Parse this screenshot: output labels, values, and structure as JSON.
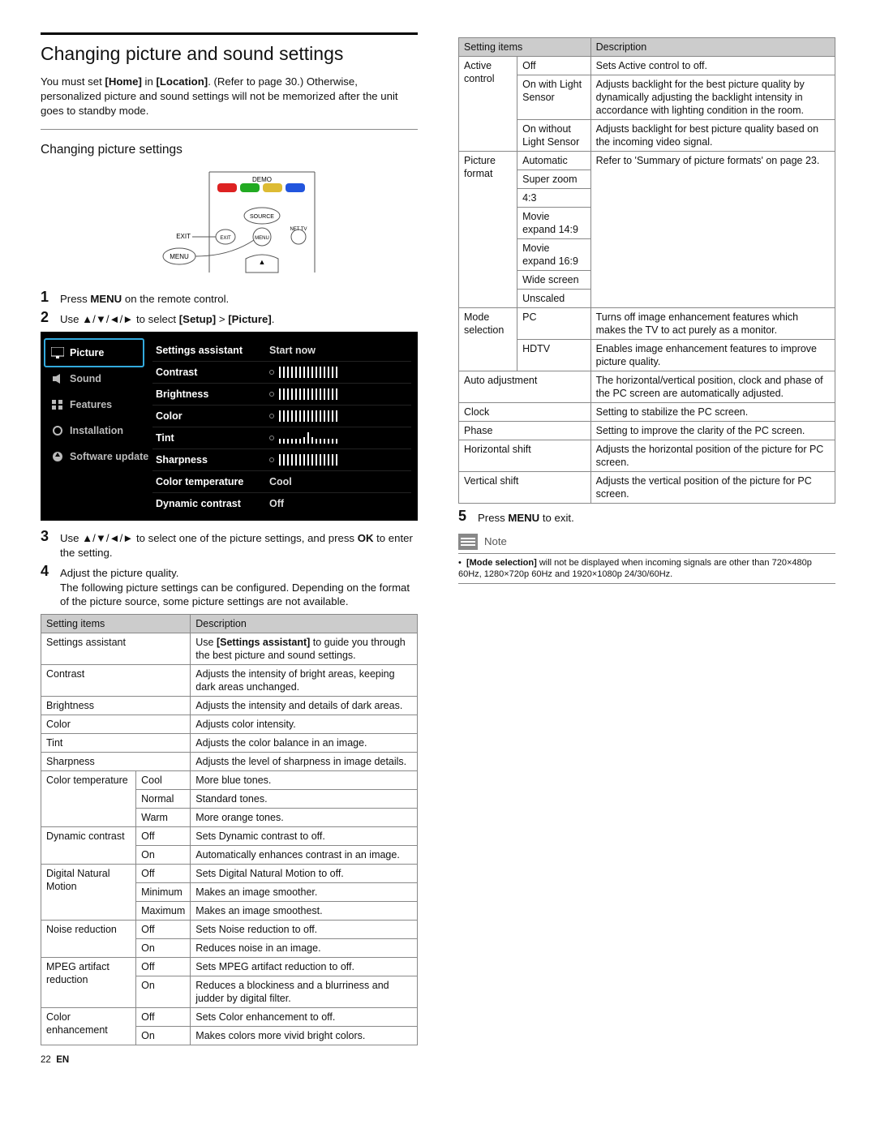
{
  "heading": "Changing picture and sound settings",
  "intro_a": "You must set ",
  "intro_home": "[Home]",
  "intro_b": " in ",
  "intro_location": "[Location]",
  "intro_c": ". (Refer to page 30.) Otherwise, personalized picture and sound settings will not be memorized after the unit goes to standby mode.",
  "sub_heading": "Changing picture settings",
  "remote": {
    "demo": "DEMO",
    "source": "SOURCE",
    "exit_l": "EXIT",
    "exit_s": "EXIT",
    "nettv": "NET TV",
    "menu_l": "MENU",
    "menu_s": "MENU"
  },
  "step1": {
    "n": "1",
    "a": "Press ",
    "menu": "MENU",
    "b": " on the remote control."
  },
  "step2": {
    "n": "2",
    "a": "Use ▲/▼/◄/► to select ",
    "setup": "[Setup]",
    "gt": " > ",
    "picture": "[Picture]",
    "b": "."
  },
  "osd": {
    "side": [
      "Picture",
      "Sound",
      "Features",
      "Installation",
      "Software update"
    ],
    "rows": [
      {
        "label": "Settings assistant",
        "val": "Start now"
      },
      {
        "label": "Contrast",
        "type": "bar"
      },
      {
        "label": "Brightness",
        "type": "bar"
      },
      {
        "label": "Color",
        "type": "bar"
      },
      {
        "label": "Tint",
        "type": "tint"
      },
      {
        "label": "Sharpness",
        "type": "bar"
      },
      {
        "label": "Color temperature",
        "val": "Cool"
      },
      {
        "label": "Dynamic contrast",
        "val": "Off"
      }
    ]
  },
  "step3": {
    "n": "3",
    "a": "Use ▲/▼/◄/► to select one of the picture settings, and press ",
    "ok": "OK",
    "b": " to enter the setting."
  },
  "step4": {
    "n": "4",
    "a": "Adjust the picture quality.",
    "b": "The following picture settings can be configured. Depending on the format of the picture source, some picture settings are not available."
  },
  "table1": {
    "headers": [
      "Setting items",
      "Description"
    ],
    "rows": [
      {
        "c1": "Settings assistant",
        "c2a": "Use ",
        "assist": "[Settings assistant]",
        "c2b": " to guide you through the best picture and sound settings."
      },
      {
        "c1": "Contrast",
        "c2": "Adjusts the intensity of bright areas, keeping dark areas unchanged."
      },
      {
        "c1": "Brightness",
        "c2": "Adjusts the intensity and details of dark areas."
      },
      {
        "c1": "Color",
        "c2": "Adjusts color intensity."
      },
      {
        "c1": "Tint",
        "c2": "Adjusts the color balance in an image."
      },
      {
        "c1": "Sharpness",
        "c2": "Adjusts the level of sharpness in image details."
      },
      {
        "g": "Color temperature",
        "sub": [
          {
            "k": "Cool",
            "v": "More blue tones."
          },
          {
            "k": "Normal",
            "v": "Standard tones."
          },
          {
            "k": "Warm",
            "v": "More orange tones."
          }
        ]
      },
      {
        "g": "Dynamic contrast",
        "sub": [
          {
            "k": "Off",
            "v": "Sets Dynamic contrast to off."
          },
          {
            "k": "On",
            "v": "Automatically enhances contrast in an image."
          }
        ]
      },
      {
        "g": "Digital Natural Motion",
        "sub": [
          {
            "k": "Off",
            "v": "Sets Digital Natural Motion to off."
          },
          {
            "k": "Minimum",
            "v": "Makes an image smoother."
          },
          {
            "k": "Maximum",
            "v": "Makes an image smoothest."
          }
        ]
      },
      {
        "g": "Noise reduction",
        "sub": [
          {
            "k": "Off",
            "v": "Sets Noise reduction to off."
          },
          {
            "k": "On",
            "v": "Reduces noise in an image."
          }
        ]
      },
      {
        "g": "MPEG artifact reduction",
        "sub": [
          {
            "k": "Off",
            "v": "Sets MPEG artifact reduction to off."
          },
          {
            "k": "On",
            "v": "Reduces a blockiness and a blurriness and judder by digital filter."
          }
        ]
      },
      {
        "g": "Color enhancement",
        "sub": [
          {
            "k": "Off",
            "v": "Sets Color enhancement to off."
          },
          {
            "k": "On",
            "v": "Makes colors more vivid bright colors."
          }
        ]
      }
    ]
  },
  "table2": {
    "headers": [
      "Setting items",
      "Description"
    ],
    "rows2": [
      {
        "g": "Active control",
        "sub": [
          {
            "k": "Off",
            "v": "Sets Active control to off."
          },
          {
            "k": "On with Light Sensor",
            "v": "Adjusts backlight for the best picture quality by dynamically adjusting the backlight intensity in accordance with lighting condition in the room."
          },
          {
            "k": "On without Light Sensor",
            "v": "Adjusts backlight for best picture quality based on the incoming video signal."
          }
        ]
      },
      {
        "g": "Picture format",
        "desc": "Refer to 'Summary of picture formats' on page 23.",
        "opts": [
          "Automatic",
          "Super zoom",
          "4:3",
          "Movie expand 14:9",
          "Movie expand 16:9",
          "Wide screen",
          "Unscaled"
        ]
      },
      {
        "g": "Mode selection",
        "sub": [
          {
            "k": "PC",
            "v": "Turns off image enhancement features which makes the TV to act purely as a monitor."
          },
          {
            "k": "HDTV",
            "v": "Enables image enhancement features to improve picture quality."
          }
        ]
      },
      {
        "s": "Auto adjustment",
        "v": "The horizontal/vertical position, clock and phase of the PC screen are automatically adjusted."
      },
      {
        "s": "Clock",
        "v": "Setting to stabilize the PC screen."
      },
      {
        "s": "Phase",
        "v": "Setting to improve the clarity of the PC screen."
      },
      {
        "s": "Horizontal shift",
        "v": "Adjusts the horizontal position of the picture for PC screen."
      },
      {
        "s": "Vertical shift",
        "v": "Adjusts the vertical position of the picture for PC screen."
      }
    ]
  },
  "step5": {
    "n": "5",
    "a": "Press ",
    "menu": "MENU",
    "b": " to exit."
  },
  "note": {
    "label": "Note",
    "a": "[Mode selection]",
    "b": " will not be displayed when incoming signals are other than 720×480p 60Hz, 1280×720p 60Hz and 1920×1080p 24/30/60Hz."
  },
  "footer": {
    "pg": "22",
    "en": "EN"
  }
}
